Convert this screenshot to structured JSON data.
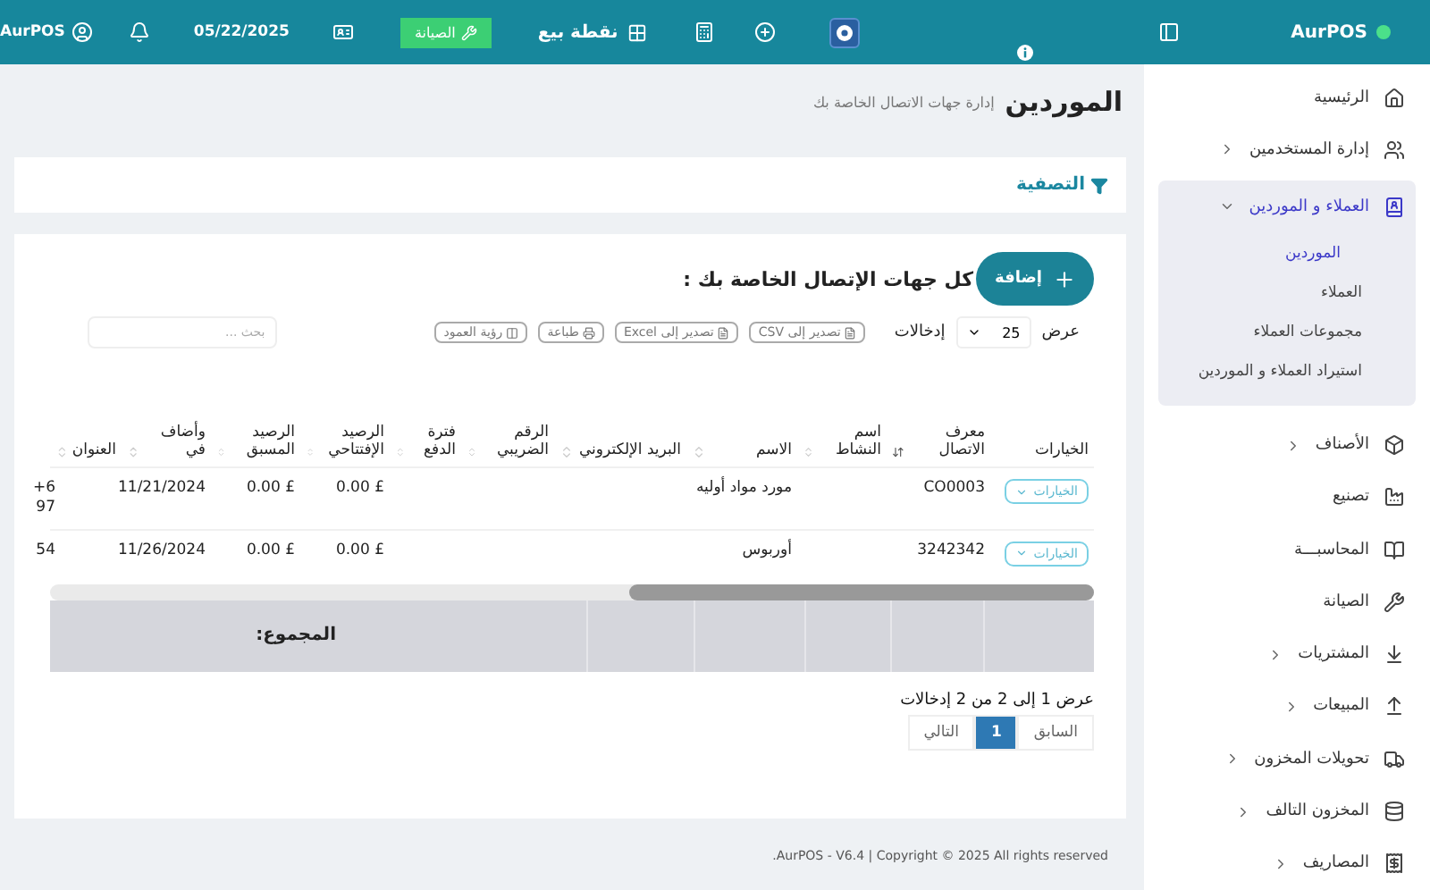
{
  "brand": "AurPOS",
  "topbar": {
    "pos_label": "نقطة بيع",
    "maintenance_button": "الصيانة",
    "date": "05/22/2025",
    "user": "AurPOS"
  },
  "sidebar": {
    "items": [
      {
        "label": "الرئيسية"
      },
      {
        "label": "إدارة المستخدمين",
        "expanded": false
      },
      {
        "label": "العملاء و الموردين",
        "expanded": true,
        "children": [
          {
            "label": "الموردين",
            "selected": true
          },
          {
            "label": "العملاء",
            "selected": false
          },
          {
            "label": "مجموعات العملاء",
            "selected": false
          },
          {
            "label": "استيراد العملاء و الموردين",
            "selected": false
          }
        ]
      },
      {
        "label": "الأصناف",
        "expanded": false
      },
      {
        "label": "تصنيع"
      },
      {
        "label": "المحاسبـــة"
      },
      {
        "label": "الصيانة"
      },
      {
        "label": "المشتريات",
        "expanded": false
      },
      {
        "label": "المبيعات",
        "expanded": false
      },
      {
        "label": "تحويلات المخزون",
        "expanded": false
      },
      {
        "label": "المخزون التالف",
        "expanded": false
      },
      {
        "label": "المصاريف",
        "expanded": false
      }
    ]
  },
  "page": {
    "title": "الموردين",
    "subtitle": "إدارة جهات الاتصال الخاصة بك"
  },
  "filter": {
    "label": "التصفية"
  },
  "card": {
    "heading": "كل جهات الإتصال الخاصة بك :",
    "add_button": "إضافة",
    "show_label": "عرض",
    "page_size": "25",
    "entries_label": "إدخالات",
    "export_buttons": [
      "تصدير إلى CSV",
      "تصدير إلى Excel",
      "طباعة",
      "رؤية العمود"
    ],
    "search": {
      "placeholder": "بحث ..."
    }
  },
  "table": {
    "columns": [
      "الخيارات",
      "معرف الاتصال",
      "اسم النشاط",
      "الاسم",
      "البريد الإلكتروني",
      "الرقم الضريبي",
      "فترة الدفع",
      "الرصيد الإفتتاحي",
      "الرصيد المسبق",
      "وأضاف في",
      "العنوان"
    ],
    "rows": [
      {
        "cells": [
          "الخيارات",
          "CO0003",
          "",
          "مورد مواد أوليه",
          "",
          "",
          "",
          "£ 0.00",
          "£ 0.00",
          "11/21/2024",
          "",
          "6+ 97"
        ]
      },
      {
        "cells": [
          "الخيارات",
          "3242342",
          "",
          "أوربوس",
          "",
          "",
          "",
          "£ 0.00",
          "£ 0.00",
          "11/26/2024",
          "",
          "54"
        ]
      }
    ],
    "total_label": "المجموع:"
  },
  "pagination": {
    "info": "عرض 1 إلى 2 من 2 إدخالات",
    "pages": [
      {
        "label": "السابق",
        "selected": false
      },
      {
        "label": "1",
        "selected": true
      },
      {
        "label": "التالي",
        "selected": false
      }
    ]
  },
  "footer": "AurPOS - V6.4 | Copyright © 2025 All rights reserved."
}
